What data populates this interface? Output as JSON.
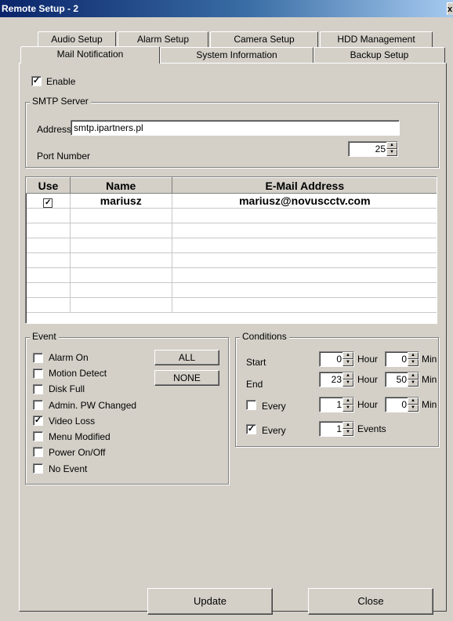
{
  "window": {
    "title": "Remote Setup - 2",
    "close_glyph": "x"
  },
  "tabs": {
    "row1": [
      "Audio Setup",
      "Alarm Setup",
      "Camera Setup",
      "HDD Management"
    ],
    "row2": [
      "Mail Notification",
      "System Information",
      "Backup Setup"
    ],
    "active": "Mail Notification"
  },
  "enable": {
    "label": "Enable",
    "checked": true
  },
  "smtp": {
    "group_title": "SMTP Server",
    "address_label": "Address",
    "address_value": "smtp.ipartners.pl",
    "port_label": "Port Number",
    "port_value": "25"
  },
  "mail_table": {
    "headers": [
      "Use",
      "Name",
      "E-Mail Address"
    ],
    "rows": [
      {
        "use": true,
        "name": "mariusz",
        "email": "mariusz@novuscctv.com"
      }
    ]
  },
  "event": {
    "group_title": "Event",
    "items": [
      {
        "label": "Alarm On",
        "checked": false
      },
      {
        "label": "Motion Detect",
        "checked": false
      },
      {
        "label": "Disk Full",
        "checked": false
      },
      {
        "label": "Admin. PW Changed",
        "checked": false
      },
      {
        "label": "Video Loss",
        "checked": true
      },
      {
        "label": "Menu Modified",
        "checked": false
      },
      {
        "label": "Power On/Off",
        "checked": false
      },
      {
        "label": "No Event",
        "checked": false
      }
    ],
    "all_label": "ALL",
    "none_label": "NONE"
  },
  "conditions": {
    "group_title": "Conditions",
    "start_label": "Start",
    "end_label": "End",
    "start_hour": "0",
    "start_min": "0",
    "end_hour": "23",
    "end_min": "50",
    "every_time": {
      "label": "Every",
      "checked": false,
      "hour": "1",
      "min": "0"
    },
    "every_events": {
      "label": "Every",
      "checked": true,
      "value": "1"
    },
    "hour_label": "Hour",
    "min_label": "Min",
    "events_label": "Events"
  },
  "footer": {
    "update_label": "Update",
    "close_label": "Close"
  },
  "icons": {
    "check": "check-icon",
    "spin_up": "up-arrow-icon",
    "spin_down": "down-arrow-icon"
  },
  "colors": {
    "face": "#d4d0c8",
    "title_start": "#0a246a",
    "title_end": "#a6caf0"
  }
}
